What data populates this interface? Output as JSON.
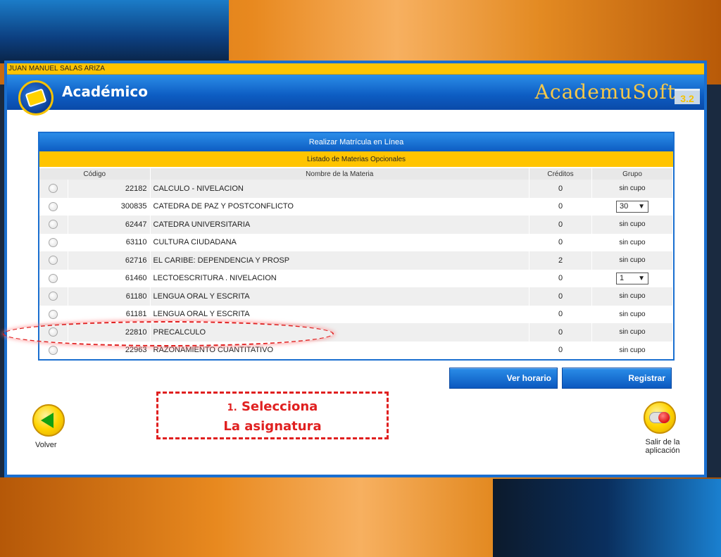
{
  "user_name": "JUAN MANUEL SALAS ARIZA",
  "header": {
    "title": "Académico",
    "brand": "AcademuSoft",
    "brand_version": "3.2"
  },
  "panel": {
    "title": "Realizar Matrícula en Línea",
    "subtitle": "Listado de Materias Opcionales",
    "columns": [
      "Código",
      "Nombre de la Materia",
      "Créditos",
      "Grupo"
    ],
    "rows": [
      {
        "code": "22182",
        "name": "CALCULO - NIVELACION",
        "credits": "0",
        "group": "sin cupo",
        "group_type": "text"
      },
      {
        "code": "300835",
        "name": "CATEDRA DE PAZ Y POSTCONFLICTO",
        "credits": "0",
        "group": "30",
        "group_type": "select"
      },
      {
        "code": "62447",
        "name": "CATEDRA UNIVERSITARIA",
        "credits": "0",
        "group": "sin cupo",
        "group_type": "text"
      },
      {
        "code": "63110",
        "name": "CULTURA CIUDADANA",
        "credits": "0",
        "group": "sin cupo",
        "group_type": "text"
      },
      {
        "code": "62716",
        "name": "EL CARIBE: DEPENDENCIA Y PROSP",
        "credits": "2",
        "group": "sin cupo",
        "group_type": "text"
      },
      {
        "code": "61460",
        "name": "LECTOESCRITURA . NIVELACION",
        "credits": "0",
        "group": "1",
        "group_type": "select"
      },
      {
        "code": "61180",
        "name": "LENGUA ORAL Y ESCRITA",
        "credits": "0",
        "group": "sin cupo",
        "group_type": "text"
      },
      {
        "code": "61181",
        "name": "LENGUA ORAL Y ESCRITA",
        "credits": "0",
        "group": "sin cupo",
        "group_type": "text"
      },
      {
        "code": "22810",
        "name": "PRECALCULO",
        "credits": "0",
        "group": "sin cupo",
        "group_type": "text"
      },
      {
        "code": "22963",
        "name": "RAZONAMIENTO CUANTITATIVO",
        "credits": "0",
        "group": "sin cupo",
        "group_type": "text"
      }
    ]
  },
  "buttons": {
    "ver_horario": "Ver horario",
    "registrar": "Registrar",
    "volver": "Volver",
    "salir": "Salir de la aplicación"
  },
  "annotation": {
    "number": "1.",
    "line1": "Selecciona",
    "line2": "La asignatura"
  },
  "icons": {
    "logo": "academic-book-icon",
    "back": "back-arrow-icon",
    "exit": "exit-toggle-icon",
    "select_arrow": "▼"
  },
  "colors": {
    "primary_blue": "#1a6fd0",
    "accent_yellow": "#ffc400",
    "annotation_red": "#e02020"
  }
}
